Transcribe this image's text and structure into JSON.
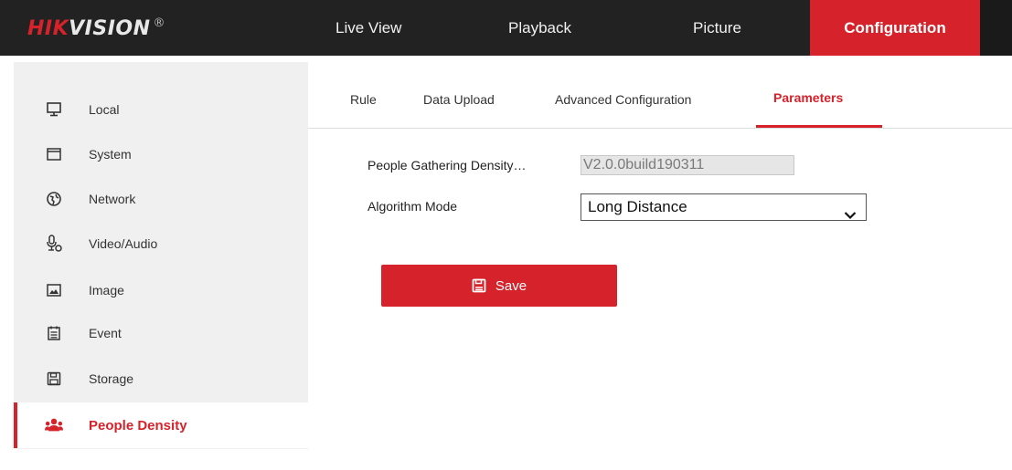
{
  "brand": {
    "logo_red": "HIK",
    "logo_white": "VISION",
    "logo_mark": "®"
  },
  "nav": {
    "live_view": "Live View",
    "playback": "Playback",
    "picture": "Picture",
    "configuration": "Configuration"
  },
  "sidebar": {
    "items": [
      {
        "label": "Local",
        "icon": "monitor-icon"
      },
      {
        "label": "System",
        "icon": "window-icon"
      },
      {
        "label": "Network",
        "icon": "globe-icon"
      },
      {
        "label": "Video/Audio",
        "icon": "microphone-icon"
      },
      {
        "label": "Image",
        "icon": "image-icon"
      },
      {
        "label": "Event",
        "icon": "calendar-icon"
      },
      {
        "label": "Storage",
        "icon": "floppy-disk-icon"
      },
      {
        "label": "People Density",
        "icon": "people-icon",
        "active": true
      }
    ]
  },
  "tabs": {
    "rule": "Rule",
    "data_upload": "Data Upload",
    "advanced": "Advanced Configuration",
    "parameters": "Parameters"
  },
  "form": {
    "version_label": "People Gathering Density…",
    "version_value": "V2.0.0build190311",
    "algorithm_label": "Algorithm Mode",
    "algorithm_value": "Long Distance"
  },
  "save": {
    "label": "Save"
  },
  "colors": {
    "accent": "#d6222a",
    "topbar": "#222222",
    "sidebar": "#f0f0f0"
  }
}
